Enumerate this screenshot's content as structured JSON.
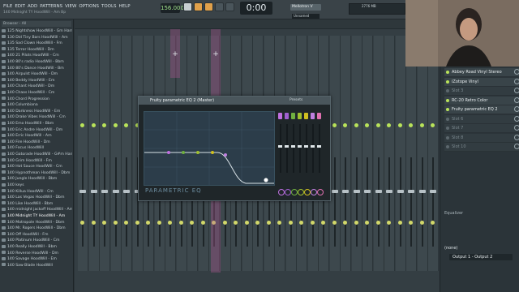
{
  "menu": [
    "FILE",
    "EDIT",
    "ADD",
    "PATTERNS",
    "VIEW",
    "OPTIONS",
    "TOOLS",
    "HELP"
  ],
  "project_title": "140 Midnight TY HoodWill - Am Bp",
  "tempo": "156.000",
  "time": "0:00",
  "pattern_label": "Unnamed",
  "channel_name": "Mellotron V",
  "cpu": "2776 MB",
  "browser": {
    "header": "Browser - All",
    "items": [
      {
        "label": "125 Nightshow HoodWill - Gm Harm",
        "selected": false
      },
      {
        "label": "130 Did Tiny Bars HoodWill - Am",
        "selected": false
      },
      {
        "label": "135 Sad Clown HoodWill - Fm",
        "selected": false
      },
      {
        "label": "135 Terror HoodWill - Dm",
        "selected": false
      },
      {
        "label": "140 21 Pilots HoodWill - Cm",
        "selected": false
      },
      {
        "label": "140 80's radio HoodWill - Bbm",
        "selected": false
      },
      {
        "label": "140 80's Dance HoodWill - Bm",
        "selected": false
      },
      {
        "label": "140 Airpulst HoodWill - Dm",
        "selected": false
      },
      {
        "label": "140 Beddy HoodWill - Em",
        "selected": false
      },
      {
        "label": "140 Chant HoodWill - Dm",
        "selected": false
      },
      {
        "label": "140 Chaos HoodWill - Cm",
        "selected": false
      },
      {
        "label": "140 Chord Progression",
        "selected": false
      },
      {
        "label": "140 Columbiana",
        "selected": false
      },
      {
        "label": "140 Darkness HoodWill - Em",
        "selected": false
      },
      {
        "label": "140 Drake Vibes HoodWill - Cm",
        "selected": false
      },
      {
        "label": "140 Emo HoodWill - Bbm",
        "selected": false
      },
      {
        "label": "140 Eric Andre HoodWill - Dm",
        "selected": false
      },
      {
        "label": "140 Erric HoodWill - Am",
        "selected": false
      },
      {
        "label": "140 Fire HoodWill - Dm",
        "selected": false
      },
      {
        "label": "140 Focus HoodWill",
        "selected": false
      },
      {
        "label": "140 Gatorade HoodWill - G#m Harm",
        "selected": false
      },
      {
        "label": "140 Grim HoodWill - Fm",
        "selected": false
      },
      {
        "label": "140 Hot Sauce HoodWill - Cm",
        "selected": false
      },
      {
        "label": "140 Hypnothrean HoodWill - Dbm",
        "selected": false
      },
      {
        "label": "140 Jungle HoodWill - Bbm",
        "selected": false
      },
      {
        "label": "140 keys",
        "selected": false
      },
      {
        "label": "140 Killua HoodWill - Cm",
        "selected": false
      },
      {
        "label": "140 Las Vegas HoodWill - Dbm",
        "selected": false
      },
      {
        "label": "140 Like HoodWill - Bbm",
        "selected": false
      },
      {
        "label": "140 midnight jackoff HoodWill - Am",
        "selected": false
      },
      {
        "label": "140 Midnight TY HoodWill - Am",
        "selected": true
      },
      {
        "label": "140 Motropole HoodWill - Dbm",
        "selected": false
      },
      {
        "label": "140 Mr. Rogers HoodWill - Dbm",
        "selected": false
      },
      {
        "label": "140 Off HoodWill - Fm",
        "selected": false
      },
      {
        "label": "140 Platinum HoodWill - Cm",
        "selected": false
      },
      {
        "label": "140 Really HoodWill - Bbm",
        "selected": false
      },
      {
        "label": "140 Reverse HoodWill - Dm",
        "selected": false
      },
      {
        "label": "140 Savage HoodWill - Em",
        "selected": false
      },
      {
        "label": "140 Saw Blade HoodWill",
        "selected": false
      }
    ]
  },
  "eq": {
    "title": "Fruity parametric EQ 2 (Master)",
    "presets": "Presets",
    "label": "PARAMETRIC EQ",
    "band_colors": [
      "#c070e0",
      "#a060d0",
      "#70b040",
      "#a0c030",
      "#d0c020",
      "#c080e0",
      "#e070b0"
    ]
  },
  "mixer_inserts": {
    "slots": [
      {
        "label": "Abbey Road Vinyl Stereo",
        "active": true
      },
      {
        "label": "iZotope Vinyl",
        "active": true
      },
      {
        "label": "Slot 3",
        "active": false
      },
      {
        "label": "RC-20 Retro Color",
        "active": true
      },
      {
        "label": "Fruity parametric EQ 2",
        "active": true
      },
      {
        "label": "Slot 6",
        "active": false
      },
      {
        "label": "Slot 7",
        "active": false
      },
      {
        "label": "Slot 8",
        "active": false
      },
      {
        "label": "Slot 10",
        "active": false
      }
    ],
    "equalizer_label": "Equalizer",
    "output_none": "(none)",
    "output": "Output 1 - Output 2"
  }
}
